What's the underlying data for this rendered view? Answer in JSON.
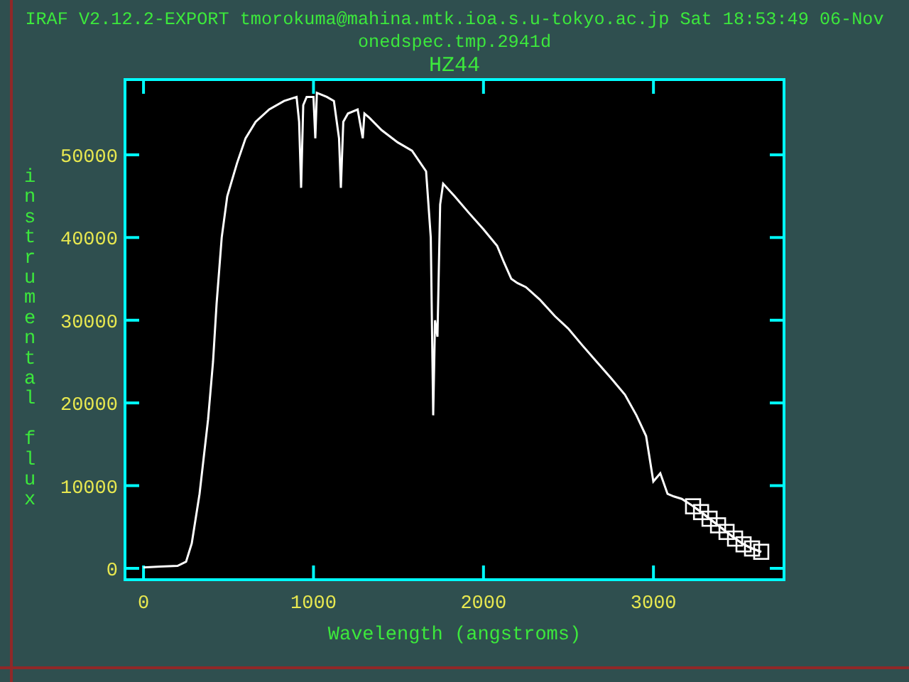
{
  "header": {
    "system_line": "IRAF V2.12.2-EXPORT tmorokuma@mahina.mtk.ioa.s.u-tokyo.ac.jp Sat 18:53:49 06-Nov",
    "task_line": "onedspec.tmp.2941d"
  },
  "plot": {
    "chart_data": {
      "type": "line",
      "title": "HZ44",
      "xlabel": "Wavelength (angstroms)",
      "ylabel": "instrumental flux",
      "xlim": [
        -109,
        3768
      ],
      "ylim": [
        -1375,
        59100
      ],
      "xticks": [
        0,
        1000,
        2000,
        3000
      ],
      "yticks": [
        0,
        10000,
        20000,
        30000,
        40000,
        50000
      ],
      "x": [
        0,
        100,
        200,
        250,
        284,
        330,
        380,
        409,
        430,
        460,
        493,
        550,
        600,
        660,
        740,
        827,
        900,
        915,
        927,
        940,
        960,
        1000,
        1011,
        1020,
        1078,
        1120,
        1150,
        1161,
        1175,
        1203,
        1260,
        1290,
        1300,
        1328,
        1400,
        1495,
        1580,
        1662,
        1690,
        1704,
        1715,
        1729,
        1745,
        1763,
        1830,
        1913,
        2000,
        2080,
        2120,
        2164,
        2200,
        2250,
        2331,
        2420,
        2498,
        2580,
        2665,
        2750,
        2832,
        2900,
        2957,
        2999,
        3040,
        3083,
        3120,
        3166,
        3233,
        3280,
        3330,
        3380,
        3430,
        3480,
        3530,
        3580,
        3634
      ],
      "series": [
        {
          "color": "#ffffff",
          "values": [
            100,
            200,
            300,
            800,
            3000,
            9000,
            18000,
            25000,
            32000,
            40000,
            45000,
            49000,
            52000,
            54000,
            55500,
            56500,
            57000,
            54000,
            46000,
            56000,
            57000,
            57000,
            52000,
            57500,
            57000,
            56500,
            52000,
            46000,
            54000,
            55000,
            55500,
            52000,
            55000,
            54500,
            53000,
            51500,
            50500,
            48000,
            40000,
            18500,
            30000,
            28000,
            44000,
            46500,
            45000,
            43000,
            41000,
            39000,
            37000,
            35000,
            34500,
            34000,
            32500,
            30500,
            29000,
            27000,
            25000,
            23000,
            21000,
            18500,
            16000,
            10500,
            11500,
            9000,
            8700,
            8400,
            7500,
            6800,
            6000,
            5200,
            4400,
            3600,
            2900,
            2400,
            2000
          ]
        },
        {
          "color": "#ffffff",
          "values": [
            null,
            null,
            null,
            null,
            null,
            null,
            null,
            null,
            null,
            null,
            null,
            null,
            null,
            null,
            null,
            null,
            null,
            null,
            null,
            null,
            null,
            null,
            null,
            null,
            null,
            null,
            null,
            null,
            null,
            null,
            null,
            null,
            null,
            null,
            null,
            null,
            null,
            null,
            null,
            null,
            null,
            null,
            null,
            null,
            null,
            null,
            null,
            null,
            null,
            null,
            null,
            null,
            null,
            null,
            null,
            null,
            null,
            null,
            null,
            null,
            null,
            null,
            null,
            null,
            null,
            null,
            7500,
            6800,
            6000,
            5200,
            4400,
            3600,
            2900,
            2400,
            2000
          ]
        }
      ]
    }
  }
}
